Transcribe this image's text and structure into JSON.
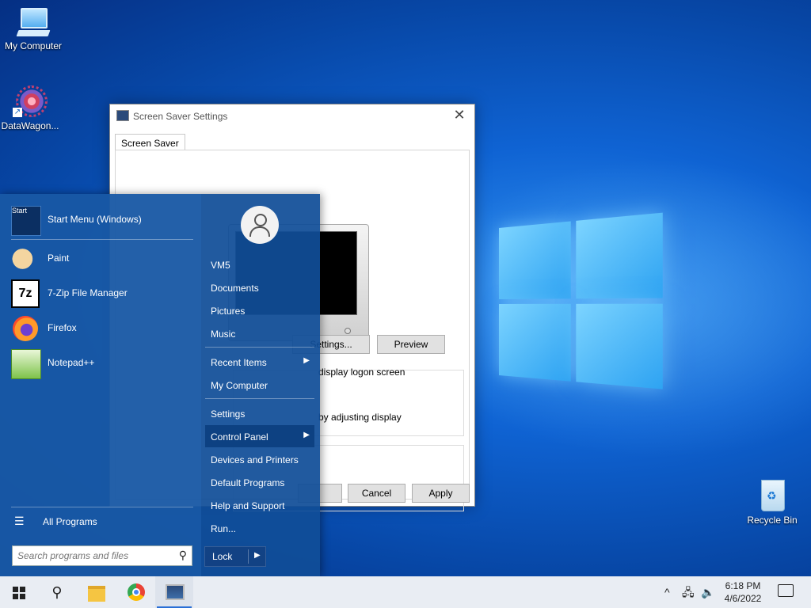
{
  "desktop": {
    "icons": [
      {
        "label": "My Computer"
      },
      {
        "label": "DataWagon..."
      },
      {
        "label": "Recycle Bin"
      }
    ]
  },
  "dialog": {
    "title": "Screen Saver Settings",
    "close_glyph": "✕",
    "tab_label": "Screen Saver",
    "settings_label": "Settings...",
    "preview_label": "Preview",
    "logon_text": "display logon screen",
    "power_text": "by adjusting display",
    "cancel_label": "Cancel",
    "apply_label": "Apply"
  },
  "start_menu": {
    "pinned": [
      {
        "label": "Start Menu (Windows)",
        "icon": "start-menu-icon"
      },
      {
        "label": "Paint",
        "icon": "paint-icon"
      },
      {
        "label": "7-Zip File Manager",
        "icon": "7zip-icon"
      },
      {
        "label": "Firefox",
        "icon": "firefox-icon"
      },
      {
        "label": "Notepad++",
        "icon": "notepadpp-icon"
      }
    ],
    "start_icon_text": "Start",
    "zip_icon_text": "7z",
    "all_programs": "All Programs",
    "search_placeholder": "Search programs and files",
    "user_name": "VM5",
    "right_items": [
      {
        "label": "VM5"
      },
      {
        "label": "Documents"
      },
      {
        "label": "Pictures"
      },
      {
        "label": "Music"
      },
      {
        "label": "Recent Items"
      },
      {
        "label": "My Computer"
      },
      {
        "label": "Settings"
      },
      {
        "label": "Control Panel"
      },
      {
        "label": "Devices and Printers"
      },
      {
        "label": "Default Programs"
      },
      {
        "label": "Help and Support"
      },
      {
        "label": "Run..."
      }
    ],
    "lock_label": "Lock",
    "arrow_glyph": "▶",
    "search_glyph": "⚲",
    "menu_glyph": "☰"
  },
  "taskbar": {
    "search_glyph": "⚲",
    "tray_chevron": "^",
    "tray_network": "🖧",
    "tray_volume": "🔈",
    "time": "6:18 PM",
    "date": "4/6/2022"
  },
  "colors": {
    "accent": "#0d4182",
    "taskbar": "#e9edf3",
    "desktop": "#0f63d3"
  }
}
